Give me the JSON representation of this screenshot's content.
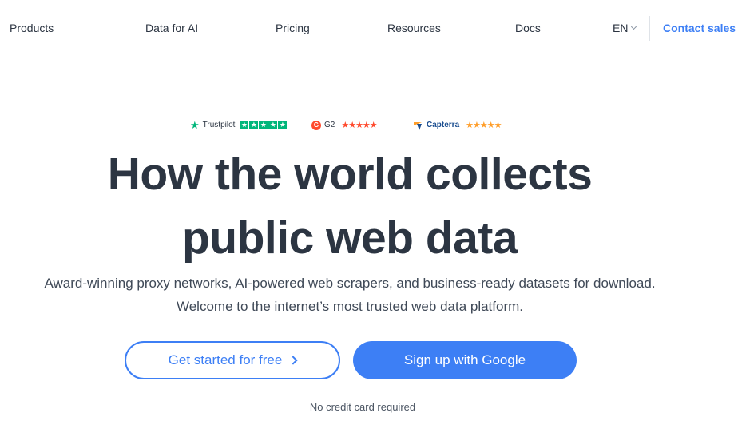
{
  "nav": {
    "items": [
      {
        "label": "Products"
      },
      {
        "label": "Data for AI"
      },
      {
        "label": "Pricing"
      },
      {
        "label": "Resources"
      },
      {
        "label": "Docs"
      }
    ],
    "language": "EN",
    "contact_label": "Contact sales"
  },
  "ratings": {
    "trustpilot": {
      "name": "Trustpilot",
      "icon": "trustpilot-star-icon",
      "color": "#00b67a"
    },
    "g2": {
      "name": "G2",
      "logo_text": "G",
      "color": "#ff492c"
    },
    "capterra": {
      "name": "Capterra",
      "colors": [
        "#ff9d28",
        "#1a4d8f"
      ]
    }
  },
  "hero": {
    "title_line1": "How the world collects",
    "title_line2": "public web data",
    "subtitle_line1": "Award-winning proxy networks, AI-powered web scrapers, and business-ready datasets for download.",
    "subtitle_line2": "Welcome to the internet’s most trusted web data platform.",
    "cta_free": "Get started for free",
    "cta_google": "Sign up with Google",
    "note": "No credit card required"
  },
  "colors": {
    "accent": "#3d7ff5",
    "text": "#2c3542"
  }
}
